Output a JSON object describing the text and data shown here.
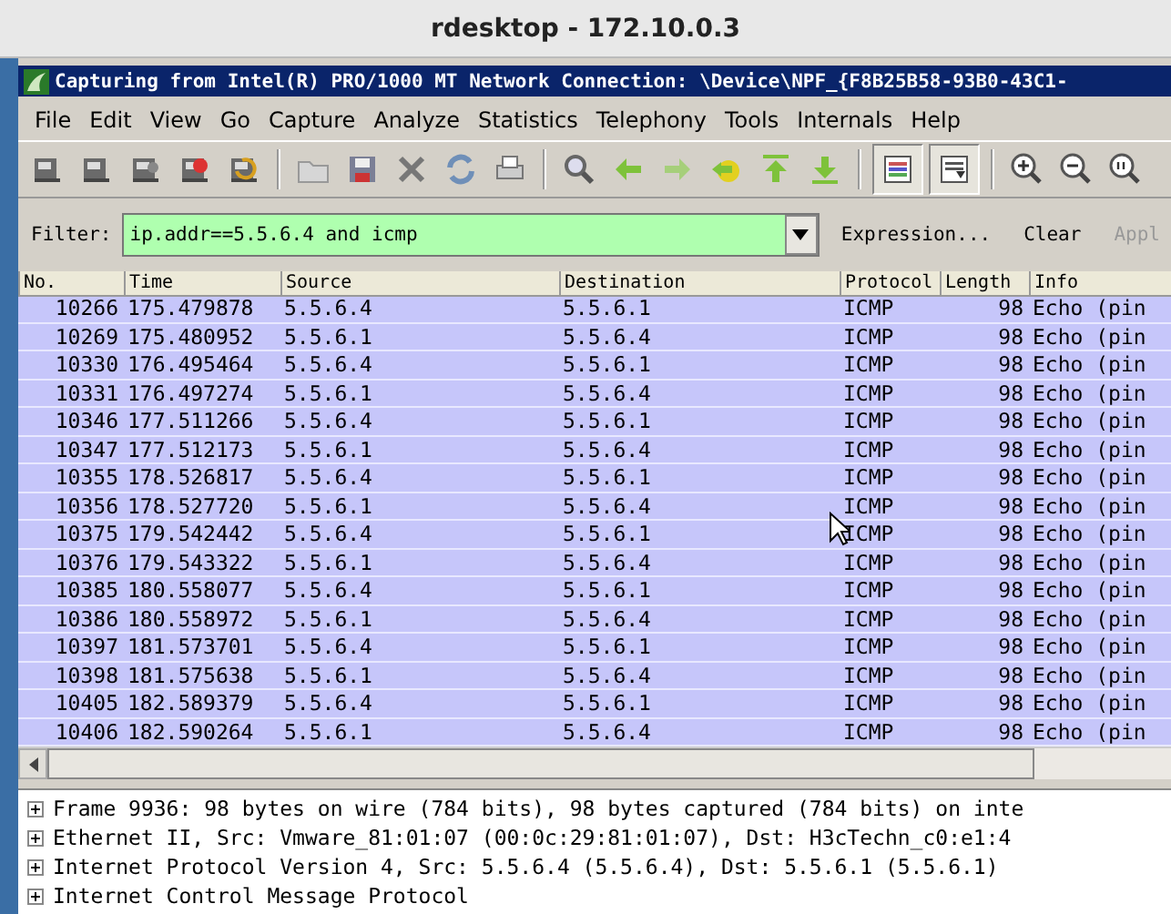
{
  "desktop_title": "rdesktop - 172.10.0.3",
  "window": {
    "title": "Capturing from Intel(R) PRO/1000 MT Network Connection: \\Device\\NPF_{F8B25B58-93B0-43C1-"
  },
  "menu": [
    "File",
    "Edit",
    "View",
    "Go",
    "Capture",
    "Analyze",
    "Statistics",
    "Telephony",
    "Tools",
    "Internals",
    "Help"
  ],
  "view_toggles": [
    {
      "on": true
    },
    {
      "on": true
    }
  ],
  "filter": {
    "label": "Filter:",
    "value": "ip.addr==5.5.6.4 and icmp",
    "buttons": [
      {
        "label": "Expression...",
        "disabled": false
      },
      {
        "label": "Clear",
        "disabled": false
      },
      {
        "label": "Appl",
        "disabled": true
      }
    ]
  },
  "table": {
    "columns": [
      "No.",
      "Time",
      "Source",
      "Destination",
      "Protocol",
      "Length",
      "Info"
    ],
    "rows": [
      [
        "10266",
        "175.479878",
        "5.5.6.4",
        "5.5.6.1",
        "ICMP",
        "98",
        "Echo (pin"
      ],
      [
        "10269",
        "175.480952",
        "5.5.6.1",
        "5.5.6.4",
        "ICMP",
        "98",
        "Echo (pin"
      ],
      [
        "10330",
        "176.495464",
        "5.5.6.4",
        "5.5.6.1",
        "ICMP",
        "98",
        "Echo (pin"
      ],
      [
        "10331",
        "176.497274",
        "5.5.6.1",
        "5.5.6.4",
        "ICMP",
        "98",
        "Echo (pin"
      ],
      [
        "10346",
        "177.511266",
        "5.5.6.4",
        "5.5.6.1",
        "ICMP",
        "98",
        "Echo (pin"
      ],
      [
        "10347",
        "177.512173",
        "5.5.6.1",
        "5.5.6.4",
        "ICMP",
        "98",
        "Echo (pin"
      ],
      [
        "10355",
        "178.526817",
        "5.5.6.4",
        "5.5.6.1",
        "ICMP",
        "98",
        "Echo (pin"
      ],
      [
        "10356",
        "178.527720",
        "5.5.6.1",
        "5.5.6.4",
        "ICMP",
        "98",
        "Echo (pin"
      ],
      [
        "10375",
        "179.542442",
        "5.5.6.4",
        "5.5.6.1",
        "ICMP",
        "98",
        "Echo (pin"
      ],
      [
        "10376",
        "179.543322",
        "5.5.6.1",
        "5.5.6.4",
        "ICMP",
        "98",
        "Echo (pin"
      ],
      [
        "10385",
        "180.558077",
        "5.5.6.4",
        "5.5.6.1",
        "ICMP",
        "98",
        "Echo (pin"
      ],
      [
        "10386",
        "180.558972",
        "5.5.6.1",
        "5.5.6.4",
        "ICMP",
        "98",
        "Echo (pin"
      ],
      [
        "10397",
        "181.573701",
        "5.5.6.4",
        "5.5.6.1",
        "ICMP",
        "98",
        "Echo (pin"
      ],
      [
        "10398",
        "181.575638",
        "5.5.6.1",
        "5.5.6.4",
        "ICMP",
        "98",
        "Echo (pin"
      ],
      [
        "10405",
        "182.589379",
        "5.5.6.4",
        "5.5.6.1",
        "ICMP",
        "98",
        "Echo (pin"
      ],
      [
        "10406",
        "182.590264",
        "5.5.6.1",
        "5.5.6.4",
        "ICMP",
        "98",
        "Echo (pin"
      ]
    ]
  },
  "details": [
    {
      "text": "Frame 9936: 98 bytes on wire (784 bits), 98 bytes captured (784 bits) on inte",
      "expanded": false
    },
    {
      "text": "Ethernet II, Src: Vmware_81:01:07 (00:0c:29:81:01:07), Dst: H3cTechn_c0:e1:4",
      "expanded": false
    },
    {
      "text": "Internet Protocol Version 4, Src: 5.5.6.4 (5.5.6.4), Dst: 5.5.6.1 (5.5.6.1)",
      "expanded": false
    },
    {
      "text": "Internet Control Message Protocol",
      "expanded": false
    }
  ]
}
